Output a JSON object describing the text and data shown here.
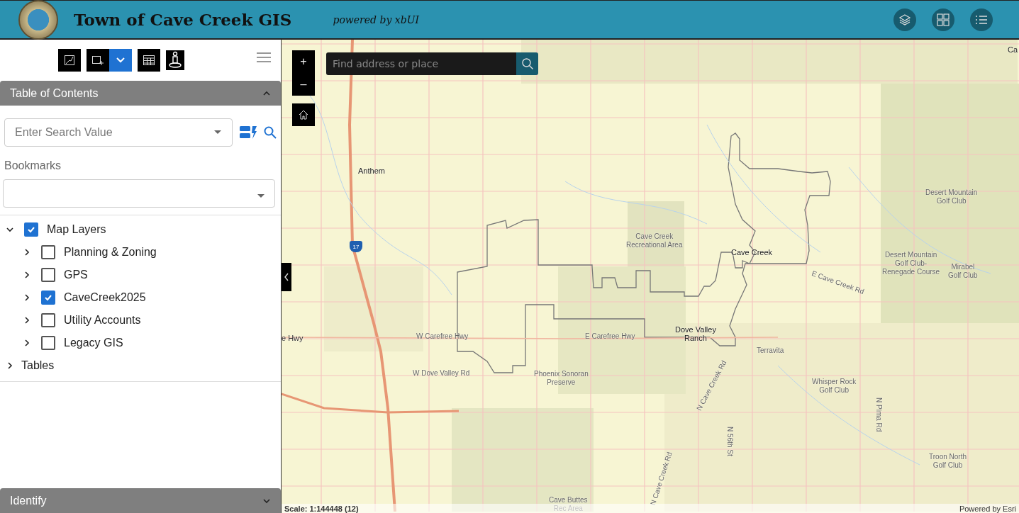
{
  "header": {
    "title": "Town of Cave Creek GIS",
    "subtitle": "powered by xbUI"
  },
  "toolbar": {
    "dropdown_open": false
  },
  "toc": {
    "title": "Table of Contents",
    "expanded": true,
    "search_placeholder": "Enter Search Value",
    "bookmarks_label": "Bookmarks",
    "layers": [
      {
        "label": "Map Layers",
        "checked": true,
        "expanded": true,
        "children": [
          {
            "label": "Planning & Zoning",
            "checked": false,
            "expanded": false
          },
          {
            "label": "GPS",
            "checked": false,
            "expanded": false
          },
          {
            "label": "CaveCreek2025",
            "checked": true,
            "expanded": false
          },
          {
            "label": "Utility Accounts",
            "checked": false,
            "expanded": false
          },
          {
            "label": "Legacy GIS",
            "checked": false,
            "expanded": false
          }
        ]
      },
      {
        "label": "Tables",
        "expanded": false
      }
    ]
  },
  "identify": {
    "title": "Identify",
    "expanded": false
  },
  "map": {
    "search_placeholder": "Find address or place",
    "zoom_in": "+",
    "zoom_out": "–",
    "scale": "Scale: 1:144448 (12)",
    "attribution": "Powered by Esri",
    "labels": [
      "Anthem",
      "Cave Creek\nRecreational Area",
      "Cave Creek",
      "Desert Mountain\nGolf Club",
      "Desert Mountain\nGolf Club-\nRenegade Course",
      "Mirabel\nGolf Club",
      "E Cave Creek Rd",
      "e Hwy",
      "W Carefree Hwy",
      "E Carefree Hwy",
      "Dove Valley\nRanch",
      "Terravita",
      "W Dove Valley Rd",
      "Phoenix Sonoran\nPreserve",
      "Whisper Rock\nGolf Club",
      "N Cave Creek Rd",
      "N 56th St",
      "N Pima Rd",
      "Troon North\nGolf Club",
      "Cave Buttes\nRec Area",
      "N Cave Creek Rd",
      "Ca",
      "17"
    ]
  }
}
